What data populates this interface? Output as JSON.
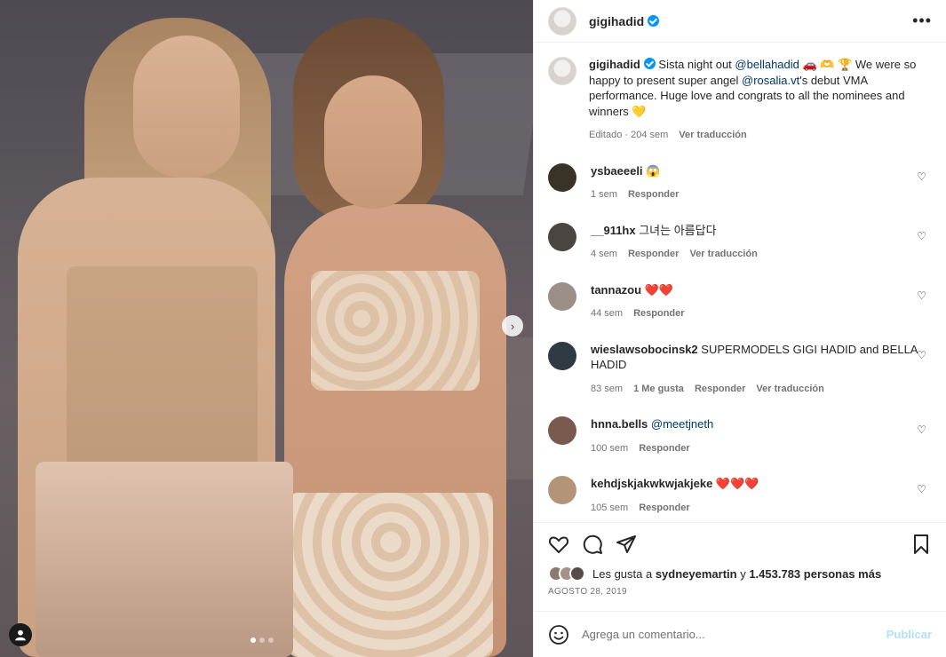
{
  "post": {
    "username": "gigihadid",
    "more_icon": "more-horizontal-icon"
  },
  "caption": {
    "username": "gigihadid",
    "text_1": "Sista night out ",
    "mention_1": "@bellahadid",
    "emojis_1": " 🚗 🫶 🏆 We were so happy to present super angel ",
    "mention_2": "@rosalia.vt",
    "text_2": "'s debut VMA performance. Huge love and congrats to all the nominees and winners 💛",
    "edited": "Editado · 204 sem",
    "translate": "Ver traducción"
  },
  "comments": [
    {
      "username": "ysbaeeeli",
      "text": " 😱",
      "time": "1 sem",
      "likes": "",
      "reply": "Responder",
      "translate": "",
      "avatar_color": "#3a3328"
    },
    {
      "username": "__911hx",
      "text": " 그녀는 아름답다",
      "time": "4 sem",
      "likes": "",
      "reply": "Responder",
      "translate": "Ver traducción",
      "avatar_color": "#4a4540"
    },
    {
      "username": "tannazou",
      "text": " ❤️❤️",
      "time": "44 sem",
      "likes": "",
      "reply": "Responder",
      "translate": "",
      "avatar_color": "#9c8f88"
    },
    {
      "username": "wieslawsobocinsk2",
      "text": " SUPERMODELS GIGI HADID and BELLA HADID",
      "time": "83 sem",
      "likes": "1 Me gusta",
      "reply": "Responder",
      "translate": "Ver traducción",
      "avatar_color": "#2f3a42"
    },
    {
      "username": "hnna.bells",
      "text": " @meetjneth",
      "time": "100 sem",
      "likes": "",
      "reply": "Responder",
      "translate": "",
      "avatar_color": "#7a5a4f"
    },
    {
      "username": "kehdjskjakwkwjakjeke",
      "text": " ❤️❤️❤️",
      "time": "105 sem",
      "likes": "",
      "reply": "Responder",
      "translate": "",
      "avatar_color": "#b39479"
    }
  ],
  "likes": {
    "prefix": "Les gusta a ",
    "user": "sydneyemartin",
    "middle": " y ",
    "count": "1.453.783 personas más"
  },
  "date": "AGOSTO 28, 2019",
  "add_comment": {
    "placeholder": "Agrega un comentario...",
    "publish": "Publicar"
  },
  "colors": {
    "accent": "#0095f6",
    "mention": "#00376b",
    "heart_red": "#ed4956"
  },
  "carousel": {
    "slides": 3,
    "active": 1
  }
}
